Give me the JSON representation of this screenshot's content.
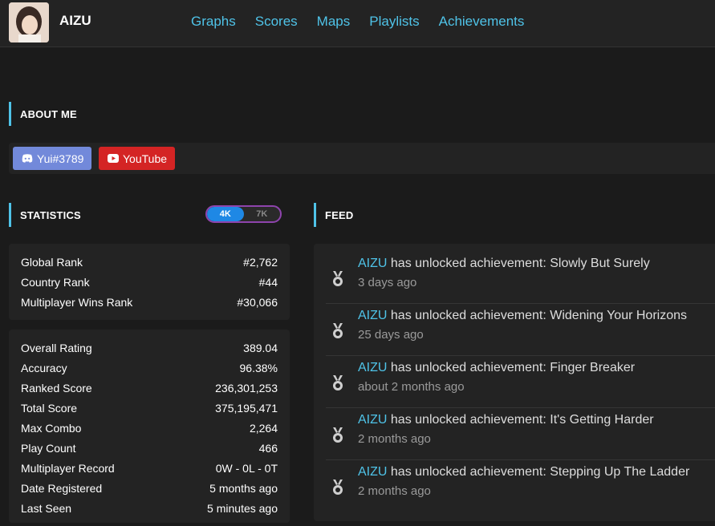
{
  "header": {
    "username": "AIZU",
    "nav": [
      "Graphs",
      "Scores",
      "Maps",
      "Playlists",
      "Achievements"
    ]
  },
  "about": {
    "title": "ABOUT ME",
    "discord": "Yui#3789",
    "youtube": "YouTube"
  },
  "statistics": {
    "title": "STATISTICS",
    "modes": [
      "4K",
      "7K"
    ],
    "active_mode": "4K",
    "ranks": [
      {
        "label": "Global Rank",
        "value": "#2,762"
      },
      {
        "label": "Country Rank",
        "value": "#44"
      },
      {
        "label": "Multiplayer Wins Rank",
        "value": "#30,066"
      }
    ],
    "details": [
      {
        "label": "Overall Rating",
        "value": "389.04"
      },
      {
        "label": "Accuracy",
        "value": "96.38%"
      },
      {
        "label": "Ranked Score",
        "value": "236,301,253"
      },
      {
        "label": "Total Score",
        "value": "375,195,471"
      },
      {
        "label": "Max Combo",
        "value": "2,264"
      },
      {
        "label": "Play Count",
        "value": "466"
      },
      {
        "label": "Multiplayer Record",
        "value": "0W - 0L - 0T"
      },
      {
        "label": "Date Registered",
        "value": "5 months ago"
      },
      {
        "label": "Last Seen",
        "value": "5 minutes ago"
      }
    ]
  },
  "feed": {
    "title": "FEED",
    "items": [
      {
        "user": "AIZU",
        "text": " has unlocked achievement: Slowly But Surely",
        "time": "3 days ago"
      },
      {
        "user": "AIZU",
        "text": " has unlocked achievement: Widening Your Horizons",
        "time": "25 days ago"
      },
      {
        "user": "AIZU",
        "text": " has unlocked achievement: Finger Breaker",
        "time": "about 2 months ago"
      },
      {
        "user": "AIZU",
        "text": " has unlocked achievement: It's Getting Harder",
        "time": "2 months ago"
      },
      {
        "user": "AIZU",
        "text": " has unlocked achievement: Stepping Up The Ladder",
        "time": "2 months ago"
      }
    ]
  },
  "colors": {
    "accent": "#4fc3e8",
    "discord": "#7289da",
    "youtube": "#d42424",
    "toggle_active": "#1e88e5",
    "toggle_border": "#8e44ad"
  },
  "icons": {
    "feed": "medal-icon",
    "discord": "discord-icon",
    "youtube": "youtube-play-icon"
  }
}
